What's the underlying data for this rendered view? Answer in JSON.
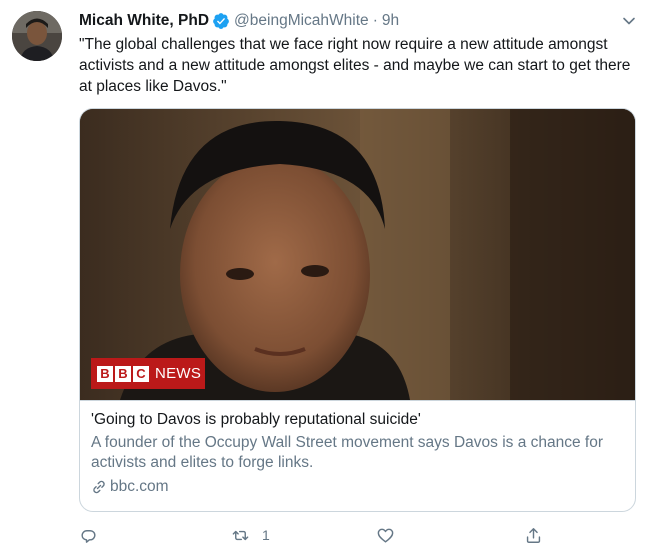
{
  "tweet": {
    "author": {
      "display_name": "Micah White, PhD",
      "handle": "@beingMicahWhite",
      "verified": true
    },
    "separator": "·",
    "timestamp": "9h",
    "text": "\"The global challenges that we face right now require a new attitude amongst activists and a new attitude amongst elites - and maybe we can start to get there at places like Davos.\"",
    "card": {
      "image_logo_blocks": [
        "B",
        "B",
        "C"
      ],
      "image_logo_word": "NEWS",
      "title": "'Going to Davos is probably reputational suicide'",
      "description": "A founder of the Occupy Wall Street movement says Davos is a chance for activists and elites to forge links.",
      "domain": "bbc.com"
    },
    "actions": {
      "reply_count": "",
      "retweet_count": "1",
      "like_count": ""
    }
  },
  "colors": {
    "text_primary": "#14171a",
    "text_secondary": "#657786",
    "border": "#ccd6dd",
    "verified_blue": "#1da1f2",
    "bbc_red": "#bb1919"
  },
  "icons": {
    "verified": "verified-badge-icon",
    "caret": "chevron-down-icon",
    "link": "link-icon",
    "reply": "reply-icon",
    "retweet": "retweet-icon",
    "like": "heart-icon",
    "share": "share-icon"
  }
}
